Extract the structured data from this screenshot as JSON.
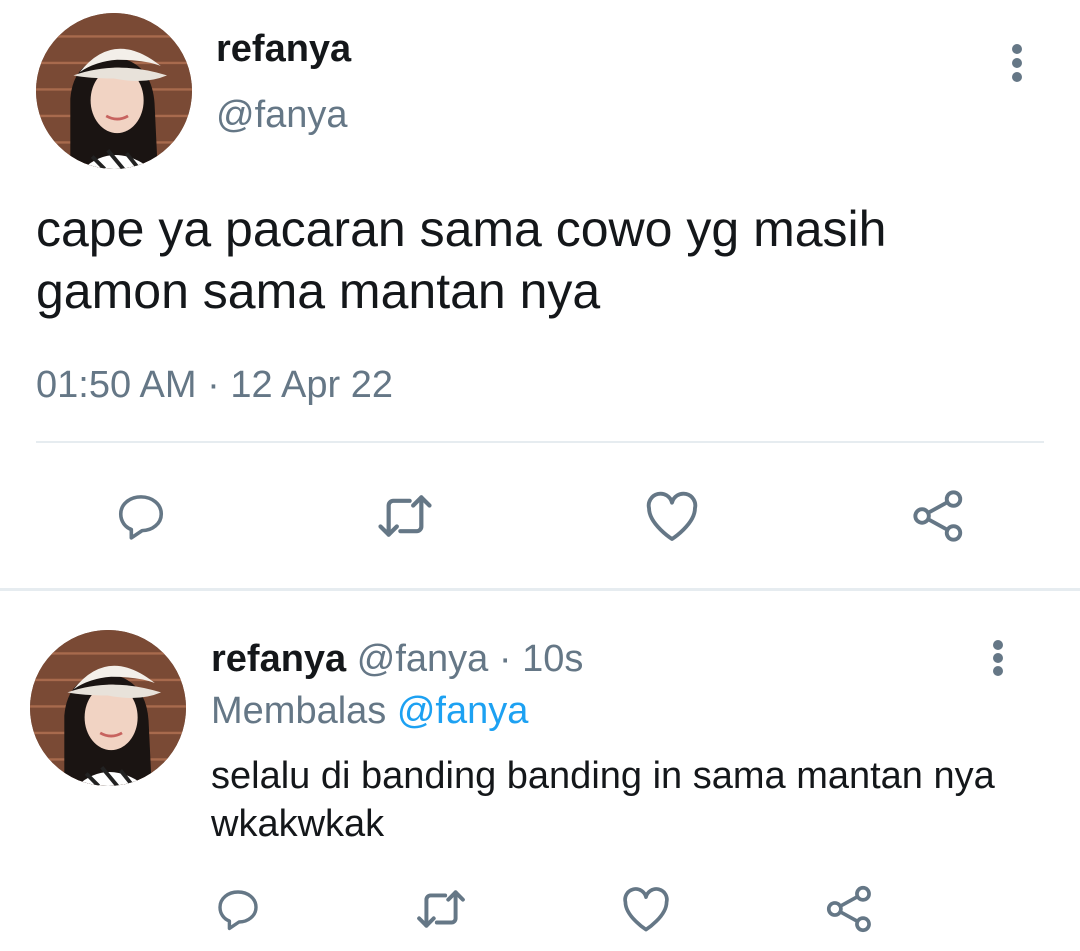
{
  "main_tweet": {
    "display_name": "refanya",
    "handle": "@fanya",
    "text": "cape ya pacaran sama cowo yg masih gamon sama mantan nya",
    "timestamp": "01:50 AM · 12 Apr 22",
    "avatar_icon": "user-avatar",
    "more_icon": "more-vertical-icon",
    "actions": [
      "reply-icon",
      "retweet-icon",
      "like-icon",
      "share-icon"
    ]
  },
  "reply_tweet": {
    "display_name": "refanya",
    "handle": "@fanya",
    "separator": "·",
    "time_ago": "10s",
    "replying_to_label": "Membalas",
    "replying_to_handle": "@fanya",
    "text": "selalu di banding banding in sama mantan nya wkakwkak",
    "avatar_icon": "user-avatar",
    "more_icon": "more-vertical-icon",
    "actions": [
      "reply-icon",
      "retweet-icon",
      "like-icon",
      "share-icon"
    ]
  },
  "colors": {
    "text_primary": "#14171a",
    "text_secondary": "#657786",
    "link": "#1da1f2",
    "divider": "#e6ecf0",
    "icon": "#657786"
  }
}
